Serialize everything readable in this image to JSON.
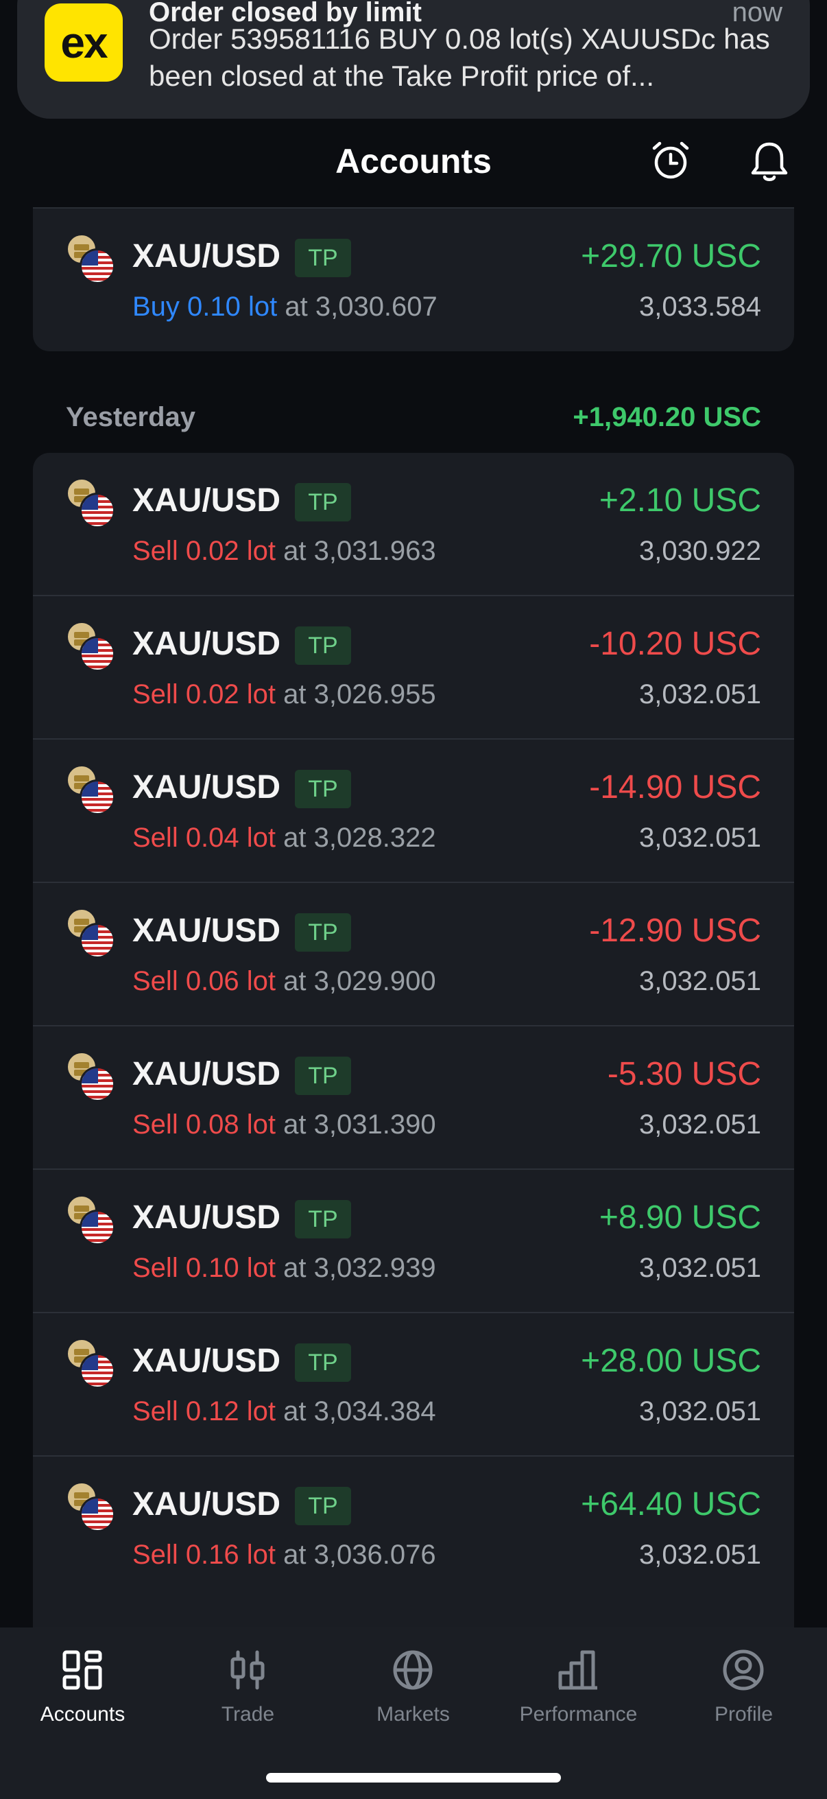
{
  "notification": {
    "app_icon_text": "ex",
    "title": "Order closed by limit",
    "time": "now",
    "body": "Order 539581116 BUY 0.08 lot(s) XAUUSDc has been closed at the Take Profit price of..."
  },
  "header": {
    "title": "Accounts",
    "alarm_icon": "alarm-clock-icon",
    "bell_icon": "bell-icon",
    "has_notification_dot": true
  },
  "open_position": {
    "symbol": "XAU/USD",
    "badge": "TP",
    "side_text": "Buy 0.10 lot",
    "at_text": " at 3,030.607",
    "pl": "+29.70 USC",
    "current_price": "3,033.584"
  },
  "section": {
    "label": "Yesterday",
    "total": "+1,940.20 USC"
  },
  "positions": [
    {
      "symbol": "XAU/USD",
      "badge": "TP",
      "side_text": "Sell 0.02 lot",
      "at_text": " at 3,031.963",
      "pl": "+2.10 USC",
      "current_price": "3,030.922"
    },
    {
      "symbol": "XAU/USD",
      "badge": "TP",
      "side_text": "Sell 0.02 lot",
      "at_text": " at 3,026.955",
      "pl": "-10.20 USC",
      "current_price": "3,032.051"
    },
    {
      "symbol": "XAU/USD",
      "badge": "TP",
      "side_text": "Sell 0.04 lot",
      "at_text": " at 3,028.322",
      "pl": "-14.90 USC",
      "current_price": "3,032.051"
    },
    {
      "symbol": "XAU/USD",
      "badge": "TP",
      "side_text": "Sell 0.06 lot",
      "at_text": " at 3,029.900",
      "pl": "-12.90 USC",
      "current_price": "3,032.051"
    },
    {
      "symbol": "XAU/USD",
      "badge": "TP",
      "side_text": "Sell 0.08 lot",
      "at_text": " at 3,031.390",
      "pl": "-5.30 USC",
      "current_price": "3,032.051"
    },
    {
      "symbol": "XAU/USD",
      "badge": "TP",
      "side_text": "Sell 0.10 lot",
      "at_text": " at 3,032.939",
      "pl": "+8.90 USC",
      "current_price": "3,032.051"
    },
    {
      "symbol": "XAU/USD",
      "badge": "TP",
      "side_text": "Sell 0.12 lot",
      "at_text": " at 3,034.384",
      "pl": "+28.00 USC",
      "current_price": "3,032.051"
    },
    {
      "symbol": "XAU/USD",
      "badge": "TP",
      "side_text": "Sell 0.16 lot",
      "at_text": " at 3,036.076",
      "pl": "+64.40 USC",
      "current_price": "3,032.051"
    }
  ],
  "tabbar": {
    "tabs": [
      {
        "label": "Accounts",
        "icon": "grid-icon",
        "active": true
      },
      {
        "label": "Trade",
        "icon": "candlestick-icon",
        "active": false
      },
      {
        "label": "Markets",
        "icon": "globe-icon",
        "active": false
      },
      {
        "label": "Performance",
        "icon": "bar-chart-icon",
        "active": false
      },
      {
        "label": "Profile",
        "icon": "user-circle-icon",
        "active": false
      }
    ]
  },
  "colors": {
    "background": "#0b0d11",
    "card": "#1a1d23",
    "positive": "#3ec96b",
    "negative": "#ef4b4b",
    "buy": "#2f88ff",
    "brand_yellow": "#ffe400"
  }
}
